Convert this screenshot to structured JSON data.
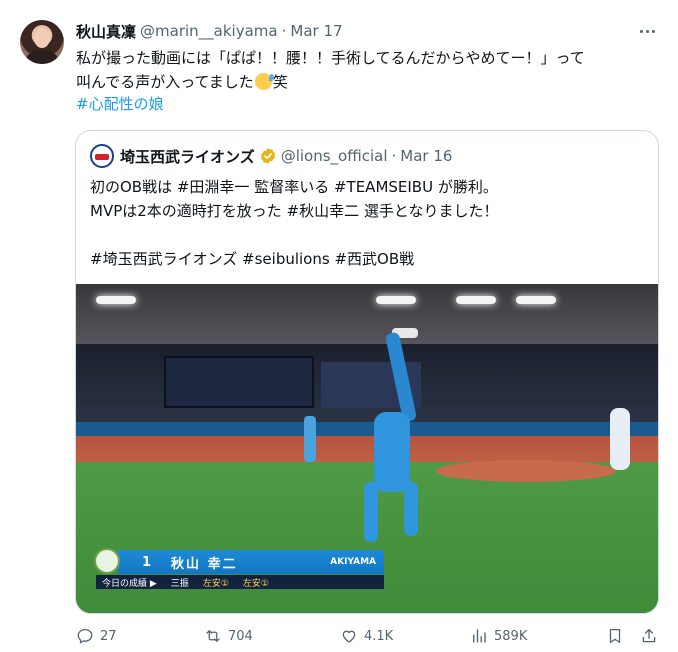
{
  "tweet": {
    "author_name": "秋山真凜",
    "handle": "@marin__akiyama",
    "separator": "·",
    "date": "Mar 17",
    "text_line1": "私が撮った動画には「ぱぱ！！腰！！手術してるんだからやめてー！」って",
    "text_line2_before": "叫んでる声が入ってました",
    "text_line2_emoji": "sweat-smile-emoji",
    "text_line2_after": "笑",
    "hashtag": "#心配性の娘"
  },
  "quote": {
    "account_name": "埼玉西武ライオンズ",
    "verified_badge": "gold-check-icon",
    "handle": "@lions_official",
    "separator": "·",
    "date": "Mar 16",
    "text": "初のOB戦は #田淵幸一 監督率いる #TEAMSEIBU が勝利。\nMVPは2本の適時打を放った #秋山幸二 選手となりました！\n\n#埼玉西武ライオンズ #seibulions #西武OB戦"
  },
  "video_overlay": {
    "number": "1",
    "player_name": "秋山 幸二",
    "player_roman": "AKIYAMA",
    "stats_label": "今日の成績 ▶",
    "results": [
      "三振",
      "左安①",
      "左安①"
    ]
  },
  "actions": {
    "replies": "27",
    "reposts": "704",
    "likes": "4.1K",
    "views": "589K"
  },
  "colors": {
    "text": "#0f1419",
    "secondary": "#536471",
    "link": "#1d9bf0",
    "border": "#cfd9de",
    "verified": "#e2b719"
  }
}
